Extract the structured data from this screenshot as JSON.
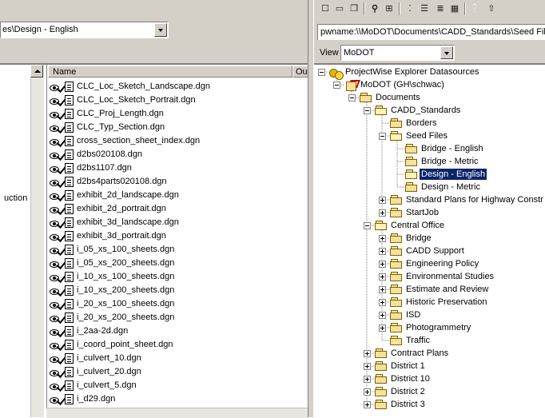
{
  "left_pane": {
    "path_value": "es\\Design - English",
    "fragment_label": "uction",
    "column_name": "Name",
    "column_owner": "Ou",
    "files": [
      "CLC_Loc_Sketch_Landscape.dgn",
      "CLC_Loc_Sketch_Portrait.dgn",
      "CLC_Proj_Length.dgn",
      "CLC_Typ_Section.dgn",
      "cross_section_sheet_index.dgn",
      "d2bs020108.dgn",
      "d2bs1107.dgn",
      "d2bs4parts020108.dgn",
      "exhibit_2d_landscape.dgn",
      "exhibit_2d_portrait.dgn",
      "exhibit_3d_landscape.dgn",
      "exhibit_3d_portrait.dgn",
      "i_05_xs_100_sheets.dgn",
      "i_05_xs_200_sheets.dgn",
      "i_10_xs_100_sheets.dgn",
      "i_10_xs_200_sheets.dgn",
      "i_20_xs_100_sheets.dgn",
      "i_20_xs_200_sheets.dgn",
      "i_2aa-2d.dgn",
      "i_coord_point_sheet.dgn",
      "i_culvert_10.dgn",
      "i_culvert_20.dgn",
      "i_culvert_5.dgn",
      "i_d29.dgn"
    ]
  },
  "right_pane": {
    "path_value": "pwname:\\\\MoDOT\\Documents\\CADD_Standards\\Seed File",
    "view_label": "View",
    "view_value": "MoDOT",
    "toolbar_icons": [
      "new-icon",
      "open-icon",
      "copy-icon",
      "find-icon",
      "map-icon",
      "small-icons-icon",
      "list-icon",
      "details-icon",
      "grid-icon",
      "help-icon",
      "up-folder-icon"
    ],
    "tree": [
      {
        "label": "ProjectWise Explorer Datasources",
        "level": 0,
        "expander": "minus",
        "icon": "datasource"
      },
      {
        "label": "MoDOT (GH\\schwac)",
        "level": 1,
        "expander": "minus",
        "icon": "database"
      },
      {
        "label": "Documents",
        "level": 2,
        "expander": "minus",
        "icon": "folder"
      },
      {
        "label": "CADD_Standards",
        "level": 3,
        "expander": "minus",
        "icon": "folder-open"
      },
      {
        "label": "Borders",
        "level": 4,
        "expander": "none",
        "icon": "folder"
      },
      {
        "label": "Seed Files",
        "level": 4,
        "expander": "minus",
        "icon": "folder-open"
      },
      {
        "label": "Bridge - English",
        "level": 5,
        "expander": "none",
        "icon": "folder"
      },
      {
        "label": "Bridge - Metric",
        "level": 5,
        "expander": "none",
        "icon": "folder"
      },
      {
        "label": "Design - English",
        "level": 5,
        "expander": "none",
        "icon": "folder-open",
        "selected": true
      },
      {
        "label": "Design - Metric",
        "level": 5,
        "expander": "none",
        "icon": "folder"
      },
      {
        "label": "Standard Plans for Highway Constr",
        "level": 4,
        "expander": "plus",
        "icon": "folder"
      },
      {
        "label": "StartJob",
        "level": 4,
        "expander": "plus",
        "icon": "folder"
      },
      {
        "label": "Central Office",
        "level": 3,
        "expander": "minus",
        "icon": "folder-open"
      },
      {
        "label": "Bridge",
        "level": 4,
        "expander": "plus",
        "icon": "folder"
      },
      {
        "label": "CADD Support",
        "level": 4,
        "expander": "plus",
        "icon": "folder"
      },
      {
        "label": "Engineering Policy",
        "level": 4,
        "expander": "plus",
        "icon": "folder"
      },
      {
        "label": "Environmental Studies",
        "level": 4,
        "expander": "plus",
        "icon": "folder"
      },
      {
        "label": "Estimate and Review",
        "level": 4,
        "expander": "plus",
        "icon": "folder"
      },
      {
        "label": "Historic Preservation",
        "level": 4,
        "expander": "plus",
        "icon": "folder"
      },
      {
        "label": "ISD",
        "level": 4,
        "expander": "plus",
        "icon": "folder"
      },
      {
        "label": "Photogrammetry",
        "level": 4,
        "expander": "plus",
        "icon": "folder"
      },
      {
        "label": "Traffic",
        "level": 4,
        "expander": "none",
        "icon": "folder"
      },
      {
        "label": "Contract Plans",
        "level": 3,
        "expander": "plus",
        "icon": "folder"
      },
      {
        "label": "District 1",
        "level": 3,
        "expander": "plus",
        "icon": "folder"
      },
      {
        "label": "District 10",
        "level": 3,
        "expander": "plus",
        "icon": "folder"
      },
      {
        "label": "District 2",
        "level": 3,
        "expander": "plus",
        "icon": "folder"
      },
      {
        "label": "District 3",
        "level": 3,
        "expander": "plus",
        "icon": "folder"
      }
    ]
  },
  "colors": {
    "selection": "#0a246a",
    "face": "#d4d0c8",
    "shadow": "#808080"
  }
}
